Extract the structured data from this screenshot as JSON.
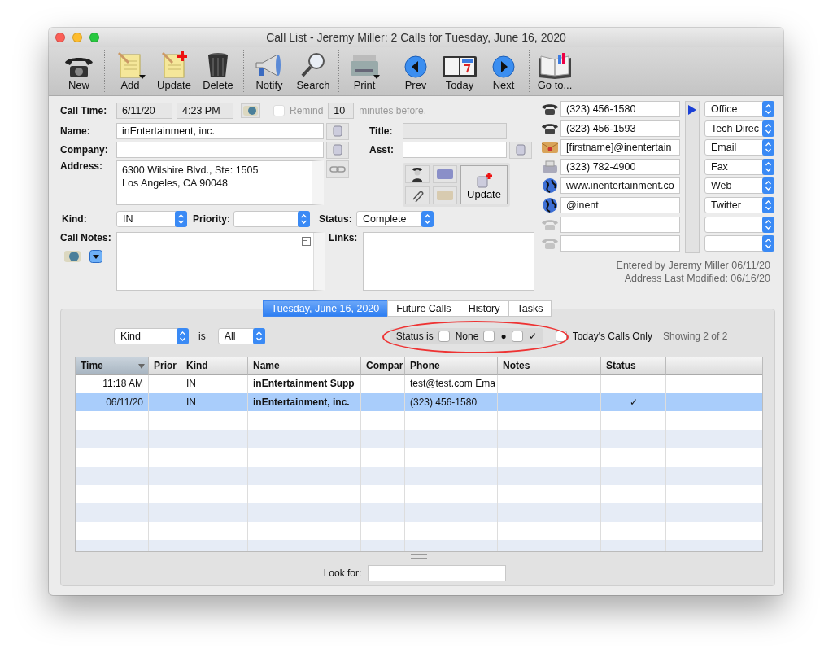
{
  "window": {
    "title": "Call List - Jeremy Miller: 2 Calls for Tuesday, June 16, 2020"
  },
  "toolbar": [
    {
      "buttons": [
        {
          "label": "New",
          "menu": false
        }
      ]
    },
    {
      "buttons": [
        {
          "label": "Add",
          "menu": true
        },
        {
          "label": "Update",
          "menu": false
        },
        {
          "label": "Delete",
          "menu": false
        }
      ]
    },
    {
      "buttons": [
        {
          "label": "Notify",
          "menu": false
        },
        {
          "label": "Search",
          "menu": false
        }
      ]
    },
    {
      "buttons": [
        {
          "label": "Print",
          "menu": true
        }
      ]
    },
    {
      "buttons": [
        {
          "label": "Prev",
          "menu": false
        },
        {
          "label": "Today",
          "menu": false
        },
        {
          "label": "Next",
          "menu": false
        }
      ]
    },
    {
      "buttons": [
        {
          "label": "Go to...",
          "menu": false
        }
      ]
    }
  ],
  "form": {
    "call_time": {
      "label": "Call Time:",
      "date": "6/11/20",
      "time": "4:23 PM"
    },
    "remind": {
      "label": "Remind",
      "checked": false,
      "disabled": true,
      "minutes": "10",
      "suffix": "minutes before."
    },
    "name": {
      "label": "Name:",
      "value": "inEntertainment, inc."
    },
    "company": {
      "label": "Company:"
    },
    "address": {
      "label": "Address:",
      "lines": [
        "6300 Wilshire Blvd., Ste: 1505",
        "Los Angeles, CA  90048"
      ]
    },
    "title": {
      "label": "Title:",
      "disabled": true
    },
    "asst": {
      "label": "Asst:",
      "disabled": false
    },
    "update_button": "Update",
    "kind": {
      "label": "Kind:",
      "value": "IN"
    },
    "priority": {
      "label": "Priority:"
    },
    "status": {
      "label": "Status:",
      "value": "Complete"
    },
    "call_notes": {
      "label": "Call Notes:"
    },
    "links": {
      "label": "Links:"
    }
  },
  "contacts": [
    {
      "kind": "phone",
      "value": "(323) 456-1580",
      "type": "Office",
      "selected": true
    },
    {
      "kind": "phone",
      "value": "(323) 456-1593",
      "type": "Tech Direc",
      "selected": false
    },
    {
      "kind": "email",
      "value": "[firstname]@inentertain",
      "type": "Email",
      "selected": false
    },
    {
      "kind": "fax",
      "value": "(323) 782-4900",
      "type": "Fax",
      "selected": false
    },
    {
      "kind": "web",
      "value": "www.inentertainment.co",
      "type": "Web",
      "selected": false
    },
    {
      "kind": "web",
      "value": "@inent",
      "type": "Twitter",
      "selected": false
    },
    {
      "kind": "blank",
      "selected": false
    },
    {
      "kind": "blank",
      "selected": false
    }
  ],
  "entered_by": "Entered by  Jeremy Miller 06/11/20",
  "address_modified": "Address Last Modified: 06/16/20",
  "tabs": [
    {
      "label": "Tuesday, June 16, 2020",
      "selected": true
    },
    {
      "label": "Future Calls",
      "selected": false
    },
    {
      "label": "History",
      "selected": false
    },
    {
      "label": "Tasks",
      "selected": false
    }
  ],
  "filter": {
    "field": "Kind",
    "is_label": "is",
    "value": "All",
    "status_label": "Status is",
    "status_options": [
      {
        "label": "None",
        "checked": false
      },
      {
        "label": "●",
        "checked": false
      },
      {
        "label": "✓",
        "checked": false
      }
    ],
    "todays_only": {
      "label": "Today's Calls Only",
      "checked": false
    },
    "showing": "Showing 2 of 2"
  },
  "table": {
    "columns": [
      {
        "label": "Time",
        "sorted": true
      },
      {
        "label": "Prior",
        "sorted": false
      },
      {
        "label": "Kind",
        "sorted": false
      },
      {
        "label": "Name",
        "sorted": false
      },
      {
        "label": "Compar",
        "sorted": false
      },
      {
        "label": "Phone",
        "sorted": false
      },
      {
        "label": "Notes",
        "sorted": false
      },
      {
        "label": "Status",
        "sorted": false
      }
    ],
    "rows": [
      {
        "selected": false,
        "time": "11:18 AM",
        "kind": "IN",
        "name": "inEntertainment Supp",
        "phone": "test@test.com Ema"
      },
      {
        "selected": true,
        "time": "06/11/20",
        "kind": "IN",
        "name": "inEntertainment, inc.",
        "phone": "(323) 456-1580",
        "status": "✓"
      }
    ]
  },
  "look_for": {
    "label": "Look for:"
  }
}
